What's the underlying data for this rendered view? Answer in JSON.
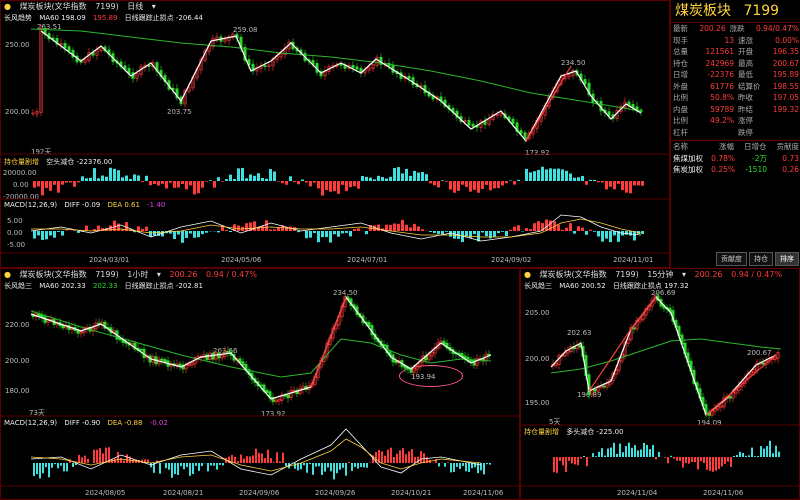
{
  "top": {
    "header": {
      "dot": "●",
      "name": "煤炭板块(文华指数",
      "code": "7199)",
      "period": "日线",
      "chevron": "▾"
    },
    "ind1": {
      "name": "长风趋势",
      "ma": "MA60 198.09",
      "v2": "195.89",
      "stop": "日线跟踪止损点 -206.44"
    },
    "prices": [
      "250.00",
      "200.00"
    ],
    "annotations": [
      "263.51",
      "259.08",
      "234.50",
      "203.75",
      "173.92"
    ],
    "days": "192天",
    "oi": {
      "label": "持仓量剧增",
      "delta": "空头减仓 -22376.00",
      "ticks": [
        "20000.00",
        "0.00",
        "-20000.00"
      ]
    },
    "macd": {
      "label": "MACD(12,26,9)",
      "diff": "DIFF -0.09",
      "dea": "DEA 0.61",
      "m": "-1.40",
      "ticks": [
        "5.00",
        "0.00",
        "-5.00"
      ]
    },
    "dates": [
      "2024/03/01",
      "2024/05/06",
      "2024/07/01",
      "2024/09/02",
      "2024/11/01"
    ]
  },
  "quote": {
    "title": "煤炭板块",
    "code": "7199",
    "rows": [
      [
        "最新",
        "200.26",
        "涨跌",
        "0.94/0.47%"
      ],
      [
        "现手",
        "13",
        "速涨",
        "0.00%"
      ],
      [
        "总量",
        "121561",
        "开盘",
        "196.35"
      ],
      [
        "持仓",
        "242969",
        "最高",
        "200.67"
      ],
      [
        "日增",
        "-22376",
        "最低",
        "195.89"
      ],
      [
        "外盘",
        "61776",
        "结算价",
        "198.55"
      ],
      [
        "比例",
        "50.8%",
        "昨收",
        "197.05"
      ],
      [
        "内盘",
        "59789",
        "昨结",
        "199.32"
      ],
      [
        "比例",
        "49.2%",
        "涨停",
        ""
      ],
      [
        "杠杆",
        "",
        "跌停",
        ""
      ]
    ],
    "sectors_header": [
      "名称",
      "涨幅",
      "日增仓",
      "贡献度"
    ],
    "sectors": [
      [
        "焦煤加权",
        "0.78%",
        "-2万",
        "0.73"
      ],
      [
        "焦炭加权",
        "0.25%",
        "-1510",
        "0.26"
      ]
    ],
    "tabs": [
      "贡献度",
      "持仓",
      "排序"
    ]
  },
  "bl": {
    "header": {
      "dot": "●",
      "name": "煤炭板块(文华指数",
      "code": "7199)",
      "period": "1小时",
      "chevron": "▾"
    },
    "ind1": {
      "name": "长风趋三",
      "ma": "MA60 202.33",
      "v2": "202.33",
      "stop": "日线跟踪止损点 -202.81"
    },
    "quote": {
      "last": "200.26",
      "chg": "0.94 / 0.47%"
    },
    "prices": [
      "220.00",
      "200.00",
      "180.00"
    ],
    "annotations": [
      "234.50",
      "203.66",
      "193.94",
      "173.92"
    ],
    "days": "73天",
    "macd": {
      "label": "MACD(12,26,9)",
      "diff": "DIFF -0.90",
      "dea": "DEA -0.88",
      "m": "-0.02"
    },
    "dates": [
      "2024/08/05",
      "2024/08/21",
      "2024/09/06",
      "2024/09/26",
      "2024/10/21",
      "2024/11/06"
    ]
  },
  "br": {
    "header": {
      "dot": "●",
      "name": "煤炭板块(文华指数",
      "code": "7199)",
      "period": "15分钟",
      "chevron": "▾"
    },
    "ind1": {
      "name": "长风趋三",
      "ma": "MA60 200.52",
      "stop": "日线跟踪止损点 197.32"
    },
    "quote": {
      "last": "200.26",
      "chg": "0.94 / 0.47%"
    },
    "prices": [
      "205.00",
      "200.00",
      "195.00"
    ],
    "annotations": [
      "206.69",
      "202.63",
      "200.67",
      "196.89",
      "194.09"
    ],
    "days": "5天",
    "oi": {
      "label": "持仓量剧增",
      "delta": "多头减仓 -225.00"
    },
    "dates": [
      "2024/11/04",
      "2024/11/06"
    ]
  },
  "colors": {
    "up": "#ff3b3b",
    "down": "#2bd92b",
    "ma": "#2bb82b",
    "trend": "#ffffff"
  }
}
